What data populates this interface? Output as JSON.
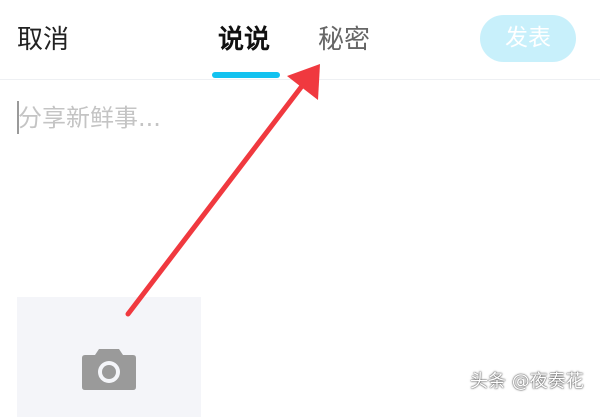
{
  "header": {
    "cancel_label": "取消",
    "tabs": [
      {
        "label": "说说",
        "active": true
      },
      {
        "label": "秘密",
        "active": false
      }
    ],
    "publish_label": "发表",
    "accent_color": "#12c2f0",
    "publish_color": "#c8f0fb"
  },
  "composer": {
    "placeholder": "分享新鲜事...",
    "value": ""
  },
  "photo_tile": {
    "icon": "camera-icon"
  },
  "annotation": {
    "arrow_color": "#f0393f"
  },
  "watermark": {
    "text": "头条 @夜奏花"
  }
}
